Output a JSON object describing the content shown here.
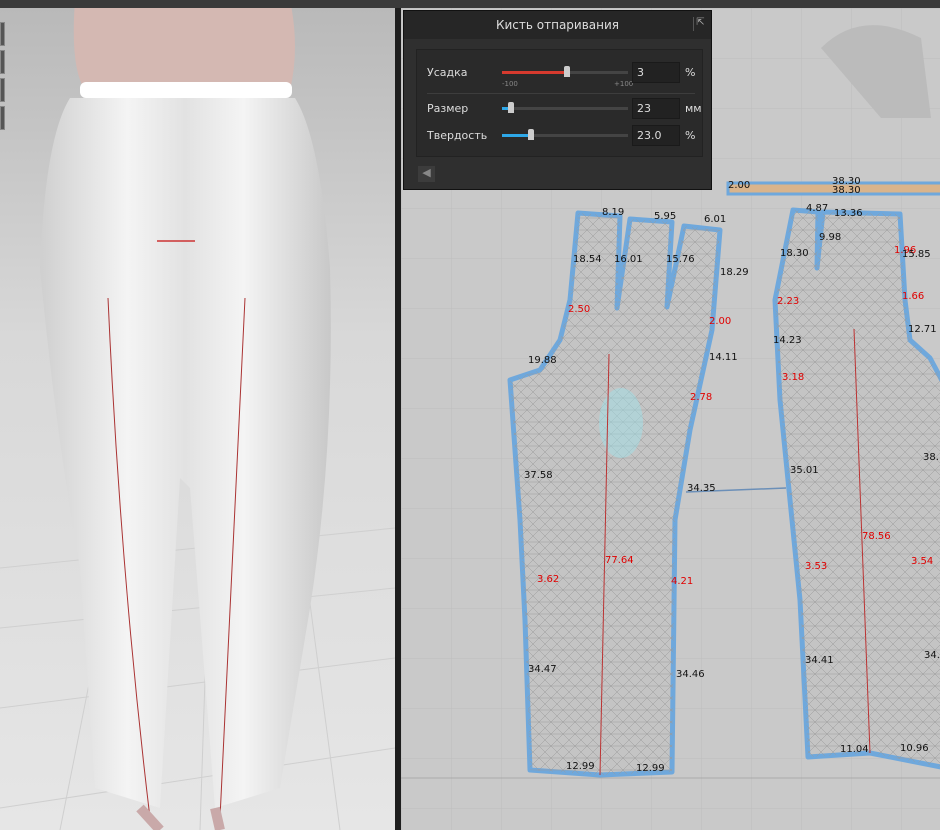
{
  "panel": {
    "title": "Кисть отпаривания",
    "shrink": {
      "label": "Усадка",
      "value": "3",
      "unit": "%",
      "min_label": "-100",
      "max_label": "+100",
      "fraction": 0.515
    },
    "size": {
      "label": "Размер",
      "value": "23",
      "unit": "мм",
      "fraction": 0.07
    },
    "hardness": {
      "label": "Твердость",
      "value": "23.0",
      "unit": "%",
      "fraction": 0.23
    }
  },
  "colors": {
    "shrink": "#d63a2e",
    "accent": "#2ea8e8",
    "outline": "#6fa8dc",
    "mesh": "#a9a9a9"
  },
  "measurements": [
    {
      "t": "8.19",
      "c": "k"
    },
    {
      "t": "5.95",
      "c": "k"
    },
    {
      "t": "6.01",
      "c": "k"
    },
    {
      "t": "18.54",
      "c": "k"
    },
    {
      "t": "16.01",
      "c": "k"
    },
    {
      "t": "15.76",
      "c": "k"
    },
    {
      "t": "18.29",
      "c": "k"
    },
    {
      "t": "2.50",
      "c": "r"
    },
    {
      "t": "2.00",
      "c": "r"
    },
    {
      "t": "19.88",
      "c": "k"
    },
    {
      "t": "14.11",
      "c": "k"
    },
    {
      "t": "2.78",
      "c": "r"
    },
    {
      "t": "37.58",
      "c": "k"
    },
    {
      "t": "34.35",
      "c": "k"
    },
    {
      "t": "3.62",
      "c": "r"
    },
    {
      "t": "77.64",
      "c": "r"
    },
    {
      "t": "4.21",
      "c": "r"
    },
    {
      "t": "34.47",
      "c": "k"
    },
    {
      "t": "34.46",
      "c": "k"
    },
    {
      "t": "12.99",
      "c": "k"
    },
    {
      "t": "12.99",
      "c": "k"
    },
    {
      "t": "4.87",
      "c": "k"
    },
    {
      "t": "13.36",
      "c": "k"
    },
    {
      "t": "9.98",
      "c": "k"
    },
    {
      "t": "18.30",
      "c": "k"
    },
    {
      "t": "1.96",
      "c": "r"
    },
    {
      "t": "15.85",
      "c": "k"
    },
    {
      "t": "2.23",
      "c": "r"
    },
    {
      "t": "1.66",
      "c": "r"
    },
    {
      "t": "12.71",
      "c": "k"
    },
    {
      "t": "14.23",
      "c": "k"
    },
    {
      "t": "3.18",
      "c": "r"
    },
    {
      "t": "35.01",
      "c": "k"
    },
    {
      "t": "38.",
      "c": "k"
    },
    {
      "t": "78.56",
      "c": "r"
    },
    {
      "t": "3.53",
      "c": "r"
    },
    {
      "t": "3.54",
      "c": "r"
    },
    {
      "t": "34.41",
      "c": "k"
    },
    {
      "t": "34.",
      "c": "k"
    },
    {
      "t": "11.04",
      "c": "k"
    },
    {
      "t": "10.96",
      "c": "k"
    },
    {
      "t": "2.00",
      "c": "k"
    },
    {
      "t": "38.30",
      "c": "k"
    },
    {
      "t": "38.30",
      "c": "k"
    }
  ]
}
